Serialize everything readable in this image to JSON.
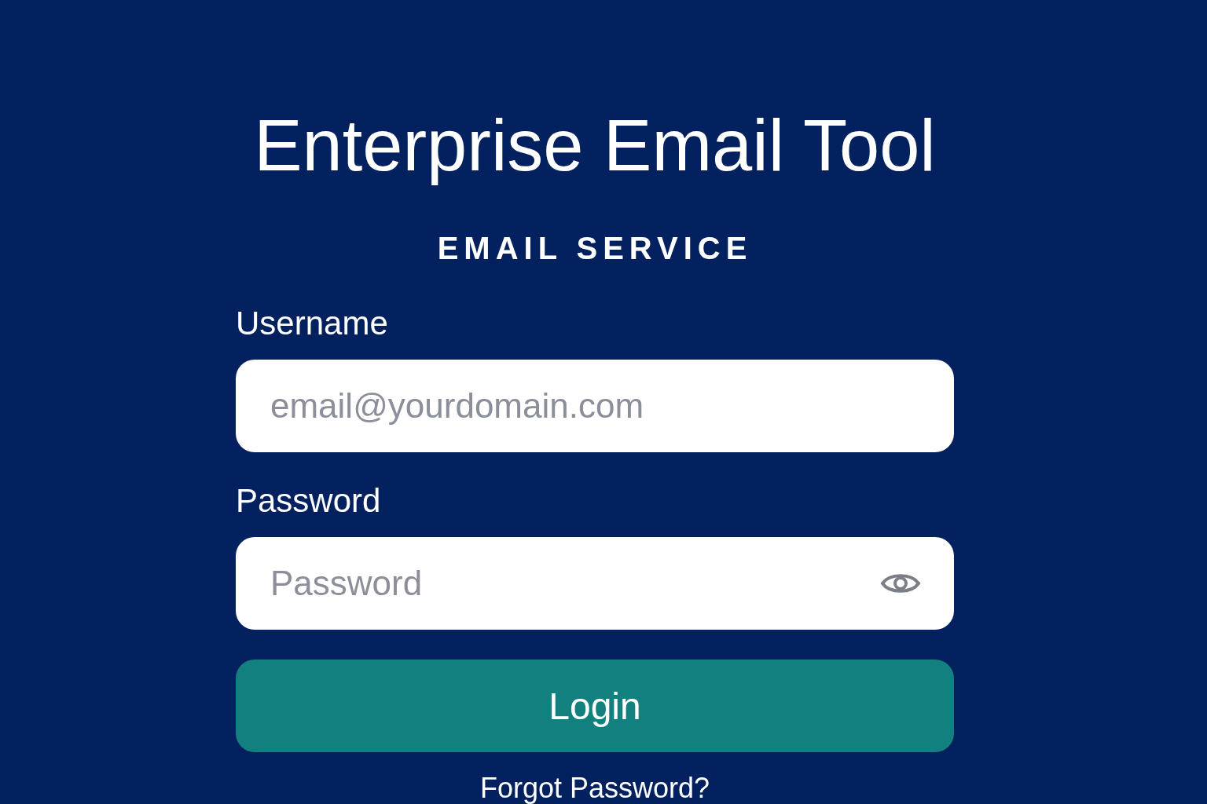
{
  "title": "Enterprise Email Tool",
  "subtitle": "EMAIL SERVICE",
  "fields": [
    {
      "label": "Username",
      "placeholder": "email@yourdomain.com",
      "kind": "text"
    },
    {
      "label": "Password",
      "placeholder": "Password",
      "kind": "password"
    }
  ],
  "login_button": "Login",
  "forgot_link": "Forgot Password?"
}
